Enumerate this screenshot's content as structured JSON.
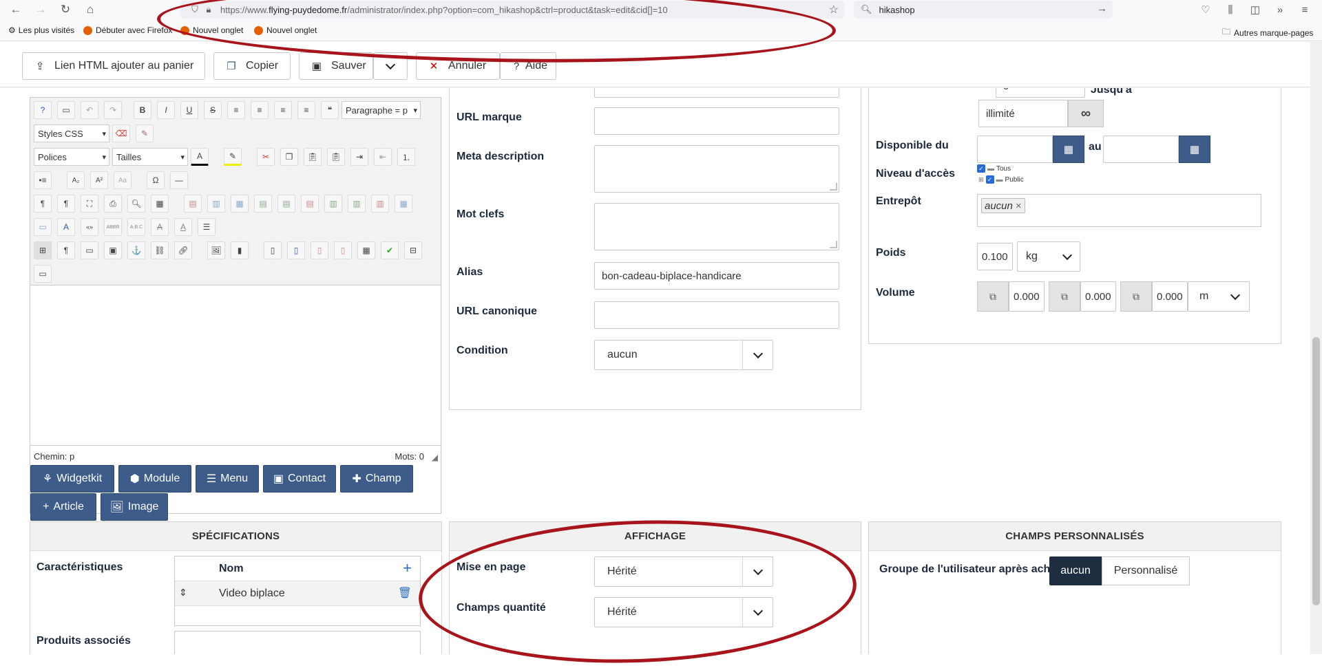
{
  "browser": {
    "url_prefix": "https://www.",
    "url_domain": "flying-puydedome.fr",
    "url_path": "/administrator/index.php?option=com_hikashop&ctrl=product&task=edit&cid[]=10",
    "search_value": "hikashop",
    "bookmarks": [
      "Les plus visités",
      "Débuter avec Firefox",
      "Nouvel onglet",
      "Nouvel onglet"
    ],
    "other_bookmarks": "Autres marque-pages"
  },
  "toolbar": {
    "add_cart_html": "Lien HTML ajouter au panier",
    "copy": "Copier",
    "save": "Sauver",
    "cancel": "Annuler",
    "help": "Aide"
  },
  "editor": {
    "paragraph_combo": "Paragraphe = p",
    "styles_combo": "Styles CSS",
    "fonts_combo": "Polices",
    "sizes_combo": "Tailles",
    "path_label": "Chemin: p",
    "word_count": "Mots: 0",
    "buttons": [
      "Widgetkit",
      "Module",
      "Menu",
      "Contact",
      "Champ",
      "Article",
      "Image"
    ]
  },
  "meta": {
    "url_marque": "URL marque",
    "meta_description": "Meta description",
    "mot_clefs": "Mot clefs",
    "alias_label": "Alias",
    "alias_value": "bon-cadeau-biplace-handicare",
    "url_canonique": "URL canonique",
    "condition_label": "Condition",
    "condition_value": "aucun"
  },
  "stock": {
    "qty_value": "0",
    "jusqua": "Jusqu'a",
    "illimite": "illimité",
    "disponible_du": "Disponible du",
    "au": "au",
    "niveau_acces": "Niveau d'accès",
    "access_tree": [
      "Tous",
      "Public"
    ],
    "entrepot": "Entrepôt",
    "entrepot_tag": "aucun",
    "poids": "Poids",
    "poids_value": "0.100",
    "poids_unit": "kg",
    "volume": "Volume",
    "volume_values": [
      "0.000",
      "0.000",
      "0.000"
    ],
    "volume_unit": "m"
  },
  "specifications": {
    "header": "SPÉCIFICATIONS",
    "caracteristiques": "Caractéristiques",
    "nom_header": "Nom",
    "row_value": "Video biplace",
    "produits_associes": "Produits associés"
  },
  "affichage": {
    "header": "AFFICHAGE",
    "mise_en_page": "Mise en page",
    "mise_en_page_value": "Hérité",
    "champs_quantite": "Champs quantité",
    "champs_quantite_value": "Hérité"
  },
  "custom_fields": {
    "header": "CHAMPS PERSONNALISÉS",
    "groupe_label": "Groupe de l'utilisateur après achat",
    "option_active": "aucun",
    "option_other": "Personnalisé"
  },
  "colors": {
    "primary_blue": "#3d5c89",
    "annotation_red": "#a8141b",
    "dark_toggle": "#1e2d40"
  }
}
